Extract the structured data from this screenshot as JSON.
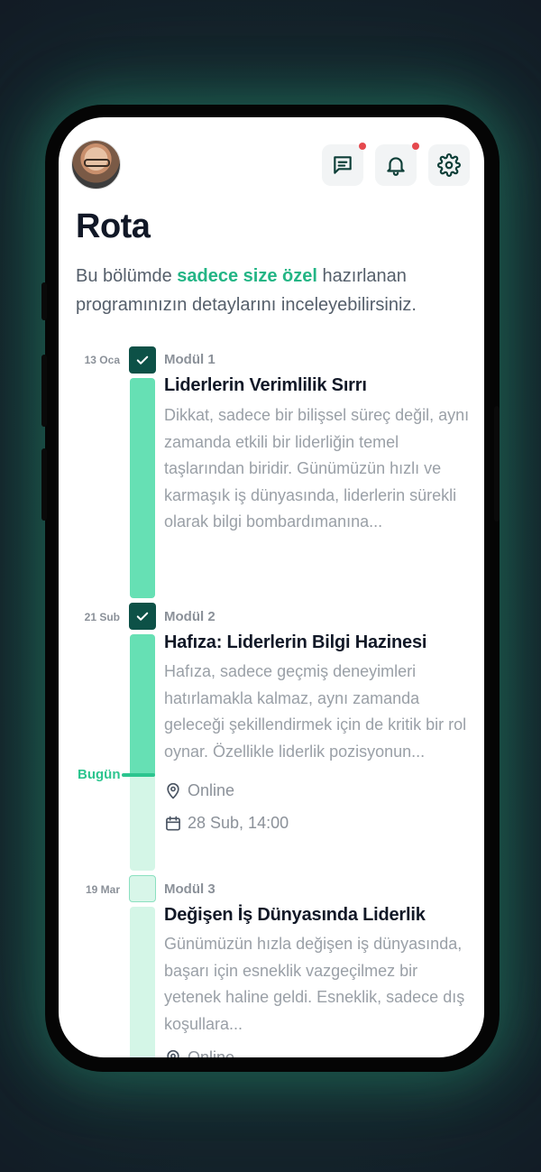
{
  "header": {
    "avatar_label": "User avatar",
    "icons": [
      "message-icon",
      "bell-icon",
      "gear-icon"
    ]
  },
  "page": {
    "title": "Rota",
    "intro_before": "Bu bölümde ",
    "intro_highlight": "sadece size özel",
    "intro_after": " hazırlanan programınızın detaylarını inceleyebilirsiniz."
  },
  "timeline": {
    "today_label": "Bugün",
    "modules": [
      {
        "date": "13 Oca",
        "label": "Modül 1",
        "title": "Liderlerin Verimlilik Sırrı",
        "description": "Dikkat, sadece bir bilişsel süreç değil, aynı zamanda etkili bir liderliğin temel taşlarından biridir. Günümüzün hızlı ve karmaşık iş dünyasında, liderlerin sürekli olarak bilgi bombardımanına...",
        "completed": true
      },
      {
        "date": "21 Sub",
        "label": "Modül 2",
        "title": "Hafıza: Liderlerin Bilgi Hazinesi",
        "description": "Hafıza, sadece geçmiş deneyimleri hatırlamakla kalmaz, aynı zamanda geleceği şekillendirmek için de kritik bir rol oynar. Özellikle liderlik pozisyonun...",
        "location": "Online",
        "datetime": "28 Sub, 14:00",
        "completed": true
      },
      {
        "date": "19 Mar",
        "label": "Modül 3",
        "title": "Değişen İş Dünyasında Liderlik",
        "description": "Günümüzün hızla değişen iş dünyasında, başarı için esneklik vazgeçilmez bir yetenek haline geldi. Esneklik, sadece dış koşullara...",
        "location": "Online",
        "completed": false
      }
    ]
  },
  "colors": {
    "accent": "#23b585",
    "dark_check": "#0d5147",
    "bar_done": "#66e0b4",
    "bar_future": "#d4f6e7",
    "notification_dot": "#e5484d"
  }
}
